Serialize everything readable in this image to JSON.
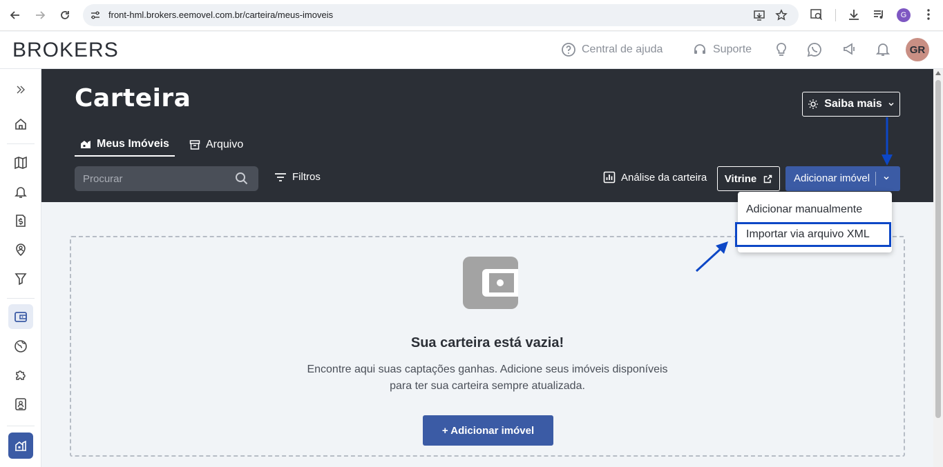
{
  "browser": {
    "url": "front-hml.brokers.eemovel.com.br/carteira/meus-imoveis",
    "profile_initial": "G"
  },
  "header": {
    "logo": "BROKERS",
    "help_label": "Central de ajuda",
    "support_label": "Suporte",
    "avatar_initials": "GR"
  },
  "page": {
    "title": "Carteira",
    "saiba_mais_label": "Saiba mais",
    "tabs": [
      {
        "label": "Meus Imóveis",
        "active": true
      },
      {
        "label": "Arquivo",
        "active": false
      }
    ],
    "search_placeholder": "Procurar",
    "filters_label": "Filtros",
    "analysis_label": "Análise da carteira",
    "vitrine_label": "Vitrine",
    "add_property_label": "Adicionar imóvel"
  },
  "dropdown": {
    "items": [
      {
        "label": "Adicionar manualmente"
      },
      {
        "label": "Importar via arquivo XML"
      }
    ]
  },
  "empty_state": {
    "title": "Sua carteira está vazia!",
    "line1": "Encontre aqui suas captações ganhas. Adicione seus imóveis disponíveis",
    "line2": "para ter sua carteira sempre atualizada.",
    "button_label": "+ Adicionar imóvel"
  },
  "colors": {
    "banner": "#2b2f36",
    "primary": "#3b5ba5",
    "annotation": "#0d47c6"
  }
}
